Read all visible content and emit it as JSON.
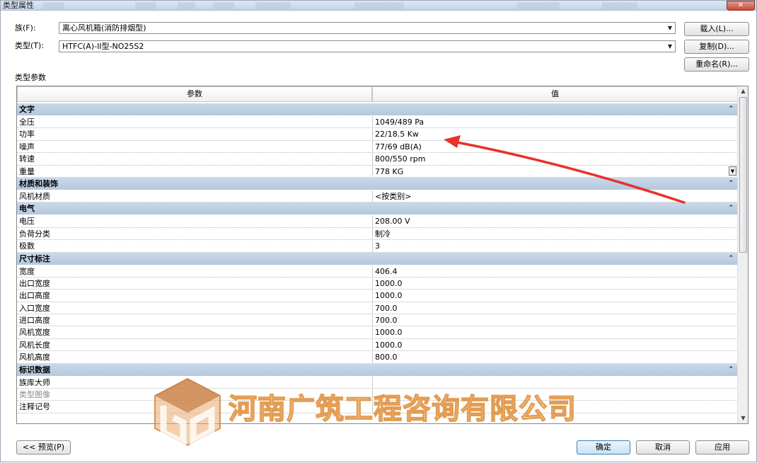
{
  "window": {
    "title": "类型属性",
    "close_glyph": "✕"
  },
  "family": {
    "label": "族(F):",
    "value": "离心风机箱(消防排烟型)"
  },
  "type": {
    "label": "类型(T):",
    "value": "HTFC(A)-II型-NO25S2"
  },
  "buttons": {
    "load": "载入(L)...",
    "duplicate": "复制(D)...",
    "rename": "重命名(R)...",
    "preview": "<< 预览(P)",
    "ok": "确定",
    "cancel": "取消",
    "apply": "应用"
  },
  "section_label": "类型参数",
  "grid": {
    "col_param": "参数",
    "col_value": "值",
    "groups": [
      {
        "name": "文字",
        "rows": [
          {
            "param": "全压",
            "value": "1049/489 Pa"
          },
          {
            "param": "功率",
            "value": "22/18.5 Kw"
          },
          {
            "param": "噪声",
            "value": "77/69 dB(A)"
          },
          {
            "param": "转速",
            "value": "800/550 rpm"
          },
          {
            "param": "重量",
            "value": "778 KG"
          }
        ]
      },
      {
        "name": "材质和装饰",
        "rows": [
          {
            "param": "风机材质",
            "value": "<按类别>"
          }
        ]
      },
      {
        "name": "电气",
        "rows": [
          {
            "param": "电压",
            "value": "208.00 V"
          },
          {
            "param": "负荷分类",
            "value": "制冷"
          },
          {
            "param": "极数",
            "value": "3"
          }
        ]
      },
      {
        "name": "尺寸标注",
        "rows": [
          {
            "param": "宽度",
            "value": "406.4"
          },
          {
            "param": "出口宽度",
            "value": "1000.0"
          },
          {
            "param": "出口高度",
            "value": "1000.0"
          },
          {
            "param": "入口宽度",
            "value": "700.0"
          },
          {
            "param": "进口高度",
            "value": "700.0"
          },
          {
            "param": "风机宽度",
            "value": "1000.0"
          },
          {
            "param": "风机长度",
            "value": "1000.0"
          },
          {
            "param": "风机高度",
            "value": "800.0"
          }
        ]
      },
      {
        "name": "标识数据",
        "rows": [
          {
            "param": "族库大师",
            "value": ""
          },
          {
            "param": "类型图像",
            "value": ""
          },
          {
            "param": "注释记号",
            "value": ""
          }
        ]
      }
    ]
  },
  "watermark": {
    "text": "河南广筑工程咨询有限公司"
  },
  "icons": {
    "dropdown": "chevron-down-icon",
    "collapse": "double-chevron-up-icon",
    "scroll_up": "scroll-up-icon",
    "scroll_down": "scroll-down-icon"
  },
  "colors": {
    "group_header": "#b9cbe0",
    "annotation_arrow": "#e8322a",
    "default_button": "#3c7fb1"
  }
}
